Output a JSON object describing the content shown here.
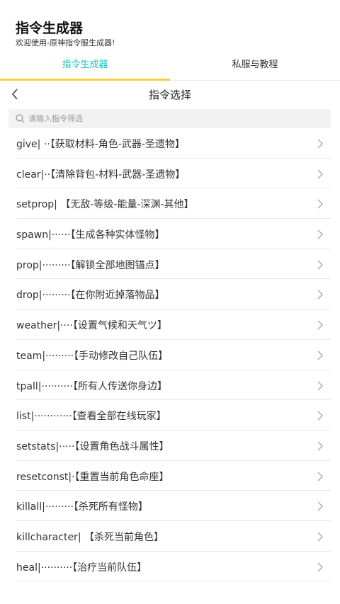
{
  "app": {
    "title": "指令生成器",
    "subtitle": "欢迎使用-原神指令服生成器!"
  },
  "tabs": [
    {
      "label": "指令生成器",
      "active": true
    },
    {
      "label": "私服与教程",
      "active": false
    }
  ],
  "colors": {
    "active_tab": "#1fbfbf",
    "indicator": "#f6cf3f"
  },
  "subheader": {
    "title": "指令选择",
    "back_icon": "chevron-left-icon"
  },
  "search": {
    "placeholder": "请输入指令筛选",
    "value": ""
  },
  "commands": [
    {
      "label": "give| ··【获取材料-角色-武器-圣遗物】"
    },
    {
      "label": "clear|··【清除背包-材料-武器-圣遗物】"
    },
    {
      "label": "setprop| 【无敌-等级-能量-深渊-其他】"
    },
    {
      "label": "spawn|······【生成各种实体怪物】"
    },
    {
      "label": "prop|·········【解锁全部地图锚点】"
    },
    {
      "label": "drop|·········【在你附近掉落物品】"
    },
    {
      "label": "weather|····【设置气候和天气ツ】"
    },
    {
      "label": "team|·········【手动修改自己队伍】"
    },
    {
      "label": "tpall|··········【所有人传送你身边】"
    },
    {
      "label": "list|············【查看全部在线玩家】"
    },
    {
      "label": "setstats|·····【设置角色战斗属性】"
    },
    {
      "label": "resetconst|·【重置当前角色命座】"
    },
    {
      "label": "killall|·········【杀死所有怪物】"
    },
    {
      "label": "killcharacter| 【杀死当前角色】"
    },
    {
      "label": "heal|··········【治疗当前队伍】"
    }
  ]
}
